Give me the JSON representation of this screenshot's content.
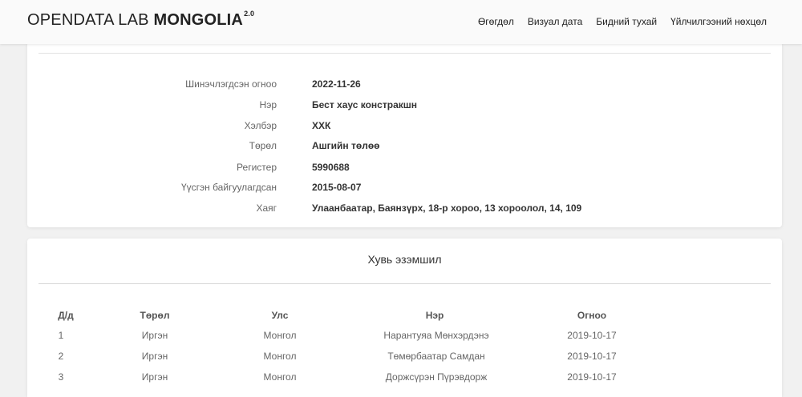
{
  "header": {
    "brand_light": "OPENDATA LAB",
    "brand_bold": "MONGOLIA",
    "brand_version": "2.0",
    "nav": [
      "Өгөгдөл",
      "Визуал дата",
      "Бидний тухай",
      "Үйлчилгээний нөхцөл"
    ]
  },
  "info": [
    {
      "label": "Шинэчлэгдсэн огноо",
      "value": "2022-11-26"
    },
    {
      "label": "Нэр",
      "value": "Бест хаус констракшн"
    },
    {
      "label": "Хэлбэр",
      "value": "ХХК"
    },
    {
      "label": "Төрөл",
      "value": "Ашгийн төлөө"
    },
    {
      "label": "Регистер",
      "value": "5990688"
    },
    {
      "label": "Үүсгэн байгуулагдсан",
      "value": "2015-08-07"
    },
    {
      "label": "Хаяг",
      "value": "Улаанбаатар, Баянзүрх, 18-р хороо, 13 хороолол, 14, 109"
    }
  ],
  "ownership": {
    "title": "Хувь эзэмшил",
    "headers": [
      "Д/д",
      "Төрөл",
      "Улс",
      "Нэр",
      "Огноо"
    ],
    "rows": [
      [
        "1",
        "Иргэн",
        "Монгол",
        "Нарантуяа Мөнхэрдэнэ",
        "2019-10-17"
      ],
      [
        "2",
        "Иргэн",
        "Монгол",
        "Төмөрбаатар Самдан",
        "2019-10-17"
      ],
      [
        "3",
        "Иргэн",
        "Монгол",
        "Доржсүрэн Пүрэвдорж",
        "2019-10-17"
      ]
    ]
  }
}
